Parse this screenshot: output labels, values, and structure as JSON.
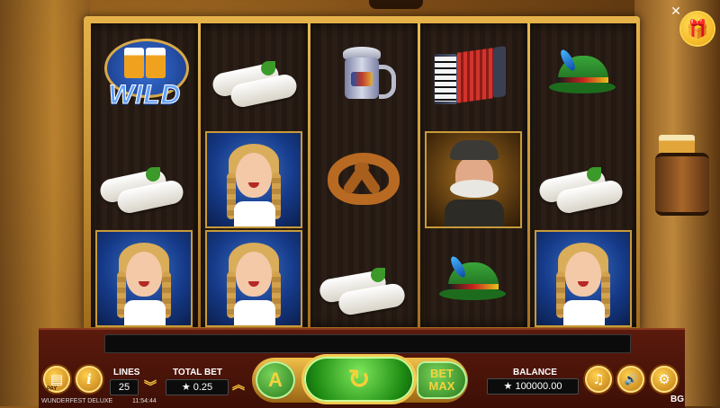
{
  "game": {
    "title": "WUNDERFEST DELUXE",
    "clock": "11:54:44",
    "provider_mark": "BG"
  },
  "top_controls": {
    "close_glyph": "✕",
    "gift_glyph": "🎁"
  },
  "reels": [
    [
      "wild",
      "white-sausage",
      "girl-card"
    ],
    [
      "white-sausage",
      "girl-card",
      "girl-card"
    ],
    [
      "beer-stein",
      "pretzel",
      "white-sausage"
    ],
    [
      "accordion",
      "old-man-card",
      "green-hat"
    ],
    [
      "green-hat",
      "white-sausage",
      "girl-card"
    ]
  ],
  "symbols": {
    "wild_text": "WILD"
  },
  "controls": {
    "paytable_label": "PAY",
    "info_glyph": "i",
    "lines_label": "LINES",
    "lines_value": "25",
    "total_bet_label": "TOTAL BET",
    "total_bet_value": "★ 0.25",
    "bet_down_glyph": "︾",
    "bet_up_glyph": "︽",
    "autoplay_label": "A",
    "spin_glyph": "↻",
    "bet_max_line1": "BET",
    "bet_max_line2": "MAX",
    "balance_label": "BALANCE",
    "balance_value": "★ 100000.00",
    "music_glyph": "♫",
    "sound_glyph": "🔊",
    "settings_glyph": "⚙"
  },
  "colors": {
    "accent_gold": "#f5c23c",
    "spin_green": "#1f8d14",
    "panel_red": "#5b1a0d"
  }
}
